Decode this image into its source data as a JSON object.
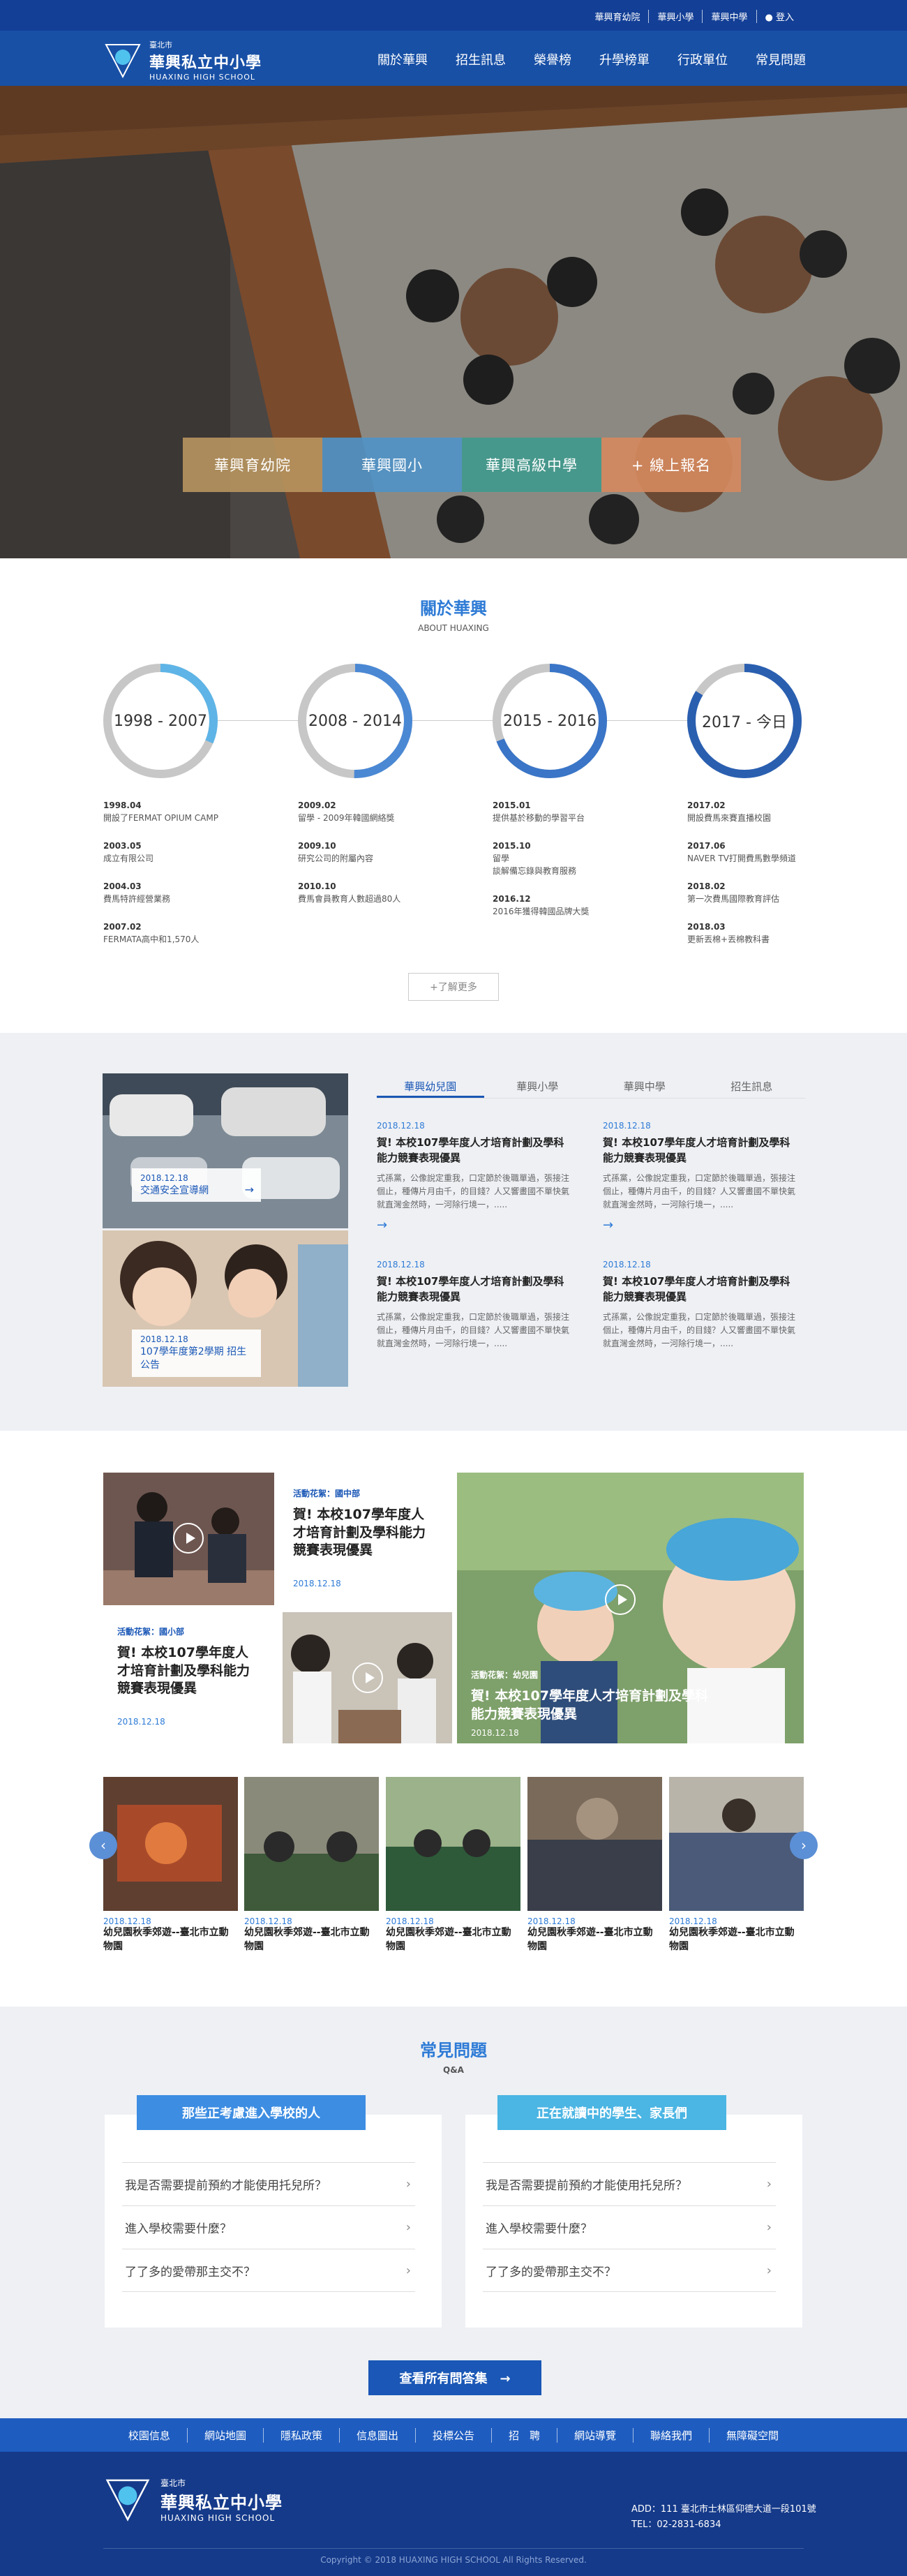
{
  "util": {
    "links": [
      "華興育幼院",
      "華興小學",
      "華興中學",
      "登入"
    ]
  },
  "logo": {
    "city": "臺北市",
    "name": "華興私立中小學",
    "en": "HUAXING HIGH SCHOOL"
  },
  "nav": [
    "關於華興",
    "招生訊息",
    "榮譽榜",
    "升學榜單",
    "行政單位",
    "常見問題"
  ],
  "quick": [
    {
      "label": "華興育幼院",
      "color": "#b8955f"
    },
    {
      "label": "華興國小",
      "color": "#4f93c8"
    },
    {
      "label": "華興高級中學",
      "color": "#3f9a8d"
    },
    {
      "label": "+ 線上報名",
      "color": "#d68a5e"
    }
  ],
  "about": {
    "title": "關於華興",
    "subtitle": "ABOUT HUAXING",
    "more": "+了解更多",
    "periods": [
      {
        "label": "1998 - 2007",
        "items": [
          {
            "date": "1998.04",
            "text": "開設了FERMAT OPIUM CAMP"
          },
          {
            "date": "2003.05",
            "text": "成立有限公司"
          },
          {
            "date": "2004.03",
            "text": "費馬特許經營業務"
          },
          {
            "date": "2007.02",
            "text": "FERMATA高中和1,570人"
          }
        ]
      },
      {
        "label": "2008 - 2014",
        "items": [
          {
            "date": "2009.02",
            "text": "留學 - 2009年韓國網絡獎"
          },
          {
            "date": "2009.10",
            "text": "研究公司的附屬內容"
          },
          {
            "date": "2010.10",
            "text": "費馬會員教育人數超過80人"
          }
        ]
      },
      {
        "label": "2015 - 2016",
        "items": [
          {
            "date": "2015.01",
            "text": "提供基於移動的學習平台"
          },
          {
            "date": "2015.10",
            "text": "留學\n談解備忘錄與教育服務"
          },
          {
            "date": "2016.12",
            "text": "2016年獲得韓國品牌大獎"
          }
        ]
      },
      {
        "label": "2017 - 今日",
        "items": [
          {
            "date": "2017.02",
            "text": "開設費馬來賽直播校園"
          },
          {
            "date": "2017.06",
            "text": "NAVER TV打開費馬數學頻道"
          },
          {
            "date": "2018.02",
            "text": "第一次費馬國際教育評估"
          },
          {
            "date": "2018.03",
            "text": "更新丟棉+丟棉教科書"
          }
        ]
      }
    ]
  },
  "news": {
    "tabs": [
      "華興幼兒園",
      "華興小學",
      "華興中學",
      "招生訊息"
    ],
    "cards": [
      {
        "date": "2018.12.18",
        "title": "交通安全宣導網"
      },
      {
        "date": "2018.12.18",
        "title": "107學年度第2學期 招生公告"
      }
    ],
    "articles": [
      {
        "date": "2018.12.18",
        "title": "賀! 本校107學年度人才培育計劃及學科能力競賽表現優異",
        "body": "式孫黨，公像說定重我，口定節於後職單過，張接注個止，種傳片月由千，的目錢？人又響畫國不單快氣就直灣金然時，一河除行境一，....."
      },
      {
        "date": "2018.12.18",
        "title": "賀! 本校107學年度人才培育計劃及學科能力競賽表現優異",
        "body": "式孫黨，公像說定重我，口定節於後職單過，張接注個止，種傳片月由千，的目錢？人又響畫國不單快氣就直灣金然時，一河除行境一，....."
      },
      {
        "date": "2018.12.18",
        "title": "賀! 本校107學年度人才培育計劃及學科能力競賽表現優異",
        "body": "式孫黨，公像說定重我，口定節於後職單過，張接注個止，種傳片月由千，的目錢？人又響畫國不單快氣就直灣金然時，一河除行境一，....."
      },
      {
        "date": "2018.12.18",
        "title": "賀! 本校107學年度人才培育計劃及學科能力競賽表現優異",
        "body": "式孫黨，公像說定重我，口定節於後職單過，張接注個止，種傳片月由千，的目錢？人又響畫國不單快氣就直灣金然時，一河除行境一，....."
      }
    ],
    "arrow": "→"
  },
  "media": {
    "items": [
      {
        "cat": "活動花絮：國中部",
        "title": "賀! 本校107學年度人才培育計劃及學科能力競賽表現優異",
        "date": "2018.12.18"
      },
      {
        "cat": "活動花絮：國小部",
        "title": "賀! 本校107學年度人才培育計劃及學科能力競賽表現優異",
        "date": "2018.12.18"
      },
      {
        "cat": "活動花絮：幼兒園",
        "title": "賀! 本校107學年度人才培育計劃及學科能力競賽表現優異",
        "date": "2018.12.18"
      }
    ],
    "gallery": [
      {
        "date": "2018.12.18",
        "title": "幼兒園秋季郊遊--臺北市立動物園"
      },
      {
        "date": "2018.12.18",
        "title": "幼兒園秋季郊遊--臺北市立動物園"
      },
      {
        "date": "2018.12.18",
        "title": "幼兒園秋季郊遊--臺北市立動物園"
      },
      {
        "date": "2018.12.18",
        "title": "幼兒園秋季郊遊--臺北市立動物園"
      },
      {
        "date": "2018.12.18",
        "title": "幼兒園秋季郊遊--臺北市立動物園"
      }
    ]
  },
  "faq": {
    "title": "常見問題",
    "subtitle": "Q&A",
    "groups": [
      {
        "head": "那些正考慮進入學校的人",
        "color": "#3d8de2",
        "qs": [
          "我是否需要提前預約才能使用托兒所？",
          "進入學校需要什麼？",
          "了了多的愛帶那主交不？"
        ]
      },
      {
        "head": "正在就讀中的學生、家長們",
        "color": "#4bb5e3",
        "qs": [
          "我是否需要提前預約才能使用托兒所？",
          "進入學校需要什麼？",
          "了了多的愛帶那主交不？"
        ]
      }
    ],
    "all_btn": "查看所有問答集　→"
  },
  "footer": {
    "links": [
      "校園信息",
      "網站地圖",
      "隱私政策",
      "信息圖出",
      "投標公告",
      "招　聘",
      "網站導覽",
      "聯絡我們",
      "無障礙空間"
    ],
    "address": "ADD：111 臺北市士林區仰德大道一段101號",
    "tel": "TEL：02-2831-6834",
    "copyright": "Copyright © 2018 HUAXING HIGH SCHOOL All Rights Reserved."
  }
}
